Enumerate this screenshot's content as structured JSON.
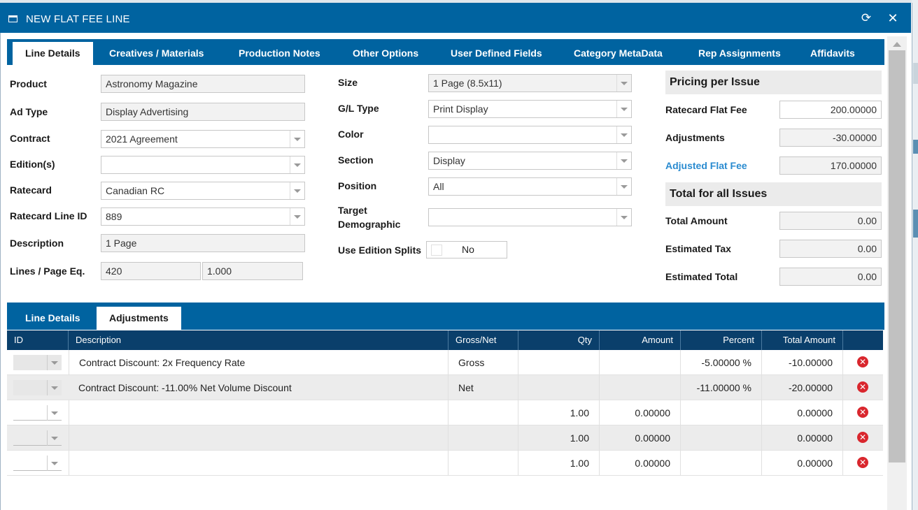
{
  "dialog": {
    "title": "NEW FLAT FEE LINE",
    "refresh_icon": "refresh-icon",
    "close_icon": "close-icon"
  },
  "tabs": [
    {
      "label": "Line Details",
      "active": true
    },
    {
      "label": "Creatives / Materials"
    },
    {
      "label": "Production Notes"
    },
    {
      "label": "Other Options"
    },
    {
      "label": "User Defined Fields"
    },
    {
      "label": "Category MetaData"
    },
    {
      "label": "Rep Assignments"
    },
    {
      "label": "Affidavits"
    }
  ],
  "left": {
    "product": {
      "label": "Product",
      "value": "Astronomy Magazine"
    },
    "ad_type": {
      "label": "Ad Type",
      "value": "Display Advertising"
    },
    "contract": {
      "label": "Contract",
      "value": "2021 Agreement"
    },
    "editions": {
      "label": "Edition(s)",
      "value": ""
    },
    "ratecard": {
      "label": "Ratecard",
      "value": "Canadian RC"
    },
    "ratecard_line_id": {
      "label": "Ratecard Line ID",
      "value": "889"
    },
    "description": {
      "label": "Description",
      "value": "1 Page"
    },
    "lines_page": {
      "label": "Lines / Page Eq.",
      "value1": "420",
      "value2": "1.000"
    }
  },
  "middle": {
    "size": {
      "label": "Size",
      "value": "1 Page (8.5x11)"
    },
    "gl_type": {
      "label": "G/L Type",
      "value": "Print Display"
    },
    "color": {
      "label": "Color",
      "value": ""
    },
    "section": {
      "label": "Section",
      "value": "Display"
    },
    "position": {
      "label": "Position",
      "value": "All"
    },
    "target_demographic": {
      "label_line1": "Target",
      "label_line2": "Demographic",
      "value": ""
    },
    "use_edition_splits": {
      "label": "Use Edition Splits",
      "value": "No"
    }
  },
  "pricing": {
    "heading": "Pricing per Issue",
    "ratecard_flat_fee": {
      "label": "Ratecard Flat Fee",
      "value": "200.00000"
    },
    "adjustments": {
      "label": "Adjustments",
      "value": "-30.00000"
    },
    "adjusted_flat_fee": {
      "label": "Adjusted Flat Fee",
      "value": "170.00000"
    },
    "total_heading": "Total for all Issues",
    "total_amount": {
      "label": "Total Amount",
      "value": "0.00"
    },
    "estimated_tax": {
      "label": "Estimated Tax",
      "value": "0.00"
    },
    "estimated_total": {
      "label": "Estimated Total",
      "value": "0.00"
    }
  },
  "subtabs": [
    {
      "label": "Line Details"
    },
    {
      "label": "Adjustments",
      "active": true
    }
  ],
  "grid": {
    "columns": [
      "ID",
      "Description",
      "Gross/Net",
      "Qty",
      "Amount",
      "Percent",
      "Total Amount"
    ],
    "rows": [
      {
        "description": "Contract Discount: 2x Frequency Rate",
        "gross_net": "Gross",
        "qty": "",
        "amount": "",
        "percent": "-5.00000 %",
        "total": "-10.00000"
      },
      {
        "description": "Contract Discount: -11.00% Net Volume Discount",
        "gross_net": "Net",
        "qty": "",
        "amount": "",
        "percent": "-11.00000 %",
        "total": "-20.00000"
      },
      {
        "description": "",
        "gross_net": "",
        "qty": "1.00",
        "amount": "0.00000",
        "percent": "",
        "total": "0.00000"
      },
      {
        "description": "",
        "gross_net": "",
        "qty": "1.00",
        "amount": "0.00000",
        "percent": "",
        "total": "0.00000"
      },
      {
        "description": "",
        "gross_net": "",
        "qty": "1.00",
        "amount": "0.00000",
        "percent": "",
        "total": "0.00000"
      }
    ]
  },
  "colors": {
    "header_blue": "#0063a0",
    "grid_header": "#0a3f6b",
    "link_blue": "#2a8bd0",
    "delete_red": "#d9272e"
  }
}
